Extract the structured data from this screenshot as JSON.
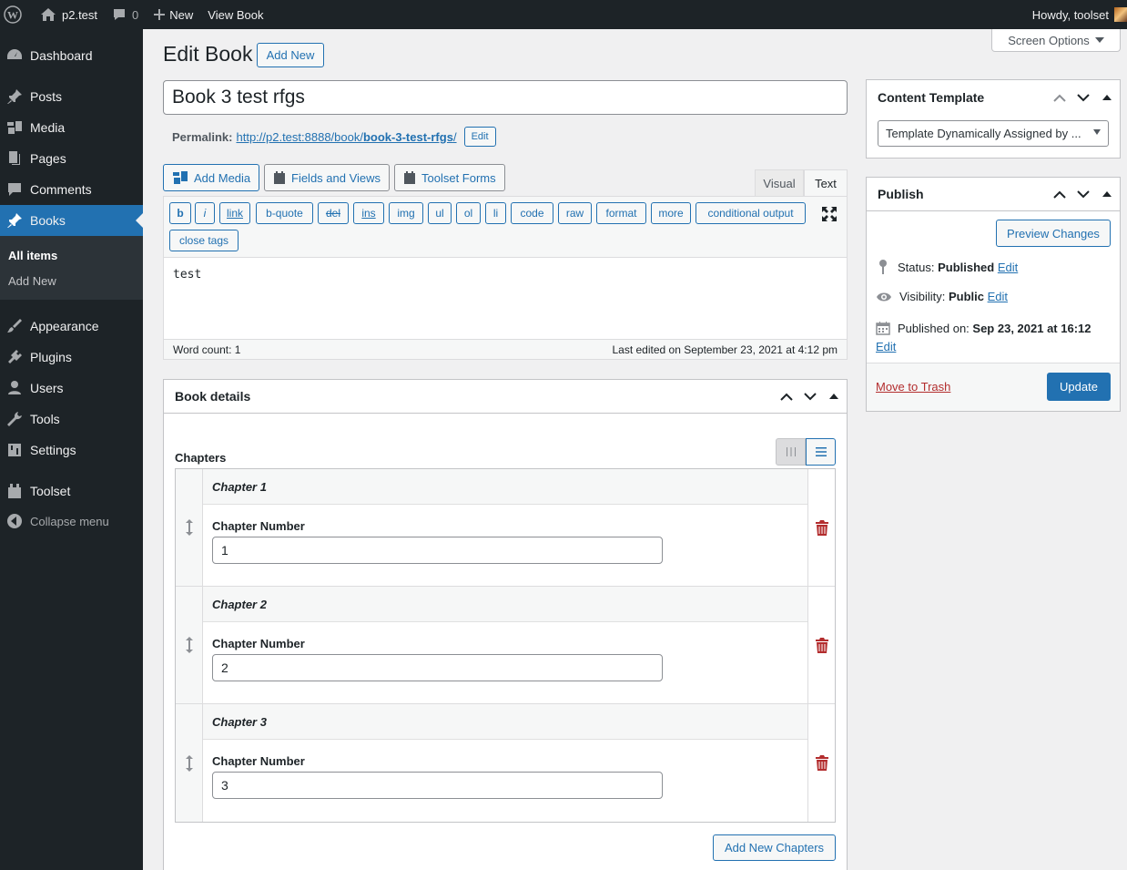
{
  "adminbar": {
    "site_name": "p2.test",
    "comments_count": "0",
    "new_label": "New",
    "view_label": "View Book",
    "howdy": "Howdy, toolset"
  },
  "sidebar": {
    "items": [
      {
        "label": "Dashboard",
        "icon": "dashboard-icon"
      },
      {
        "label": "Posts",
        "icon": "pin-icon"
      },
      {
        "label": "Media",
        "icon": "media-icon"
      },
      {
        "label": "Pages",
        "icon": "pages-icon"
      },
      {
        "label": "Comments",
        "icon": "comments-icon"
      },
      {
        "label": "Books",
        "icon": "pin-icon"
      },
      {
        "label": "Appearance",
        "icon": "brush-icon"
      },
      {
        "label": "Plugins",
        "icon": "plug-icon"
      },
      {
        "label": "Users",
        "icon": "users-icon"
      },
      {
        "label": "Tools",
        "icon": "wrench-icon"
      },
      {
        "label": "Settings",
        "icon": "settings-icon"
      },
      {
        "label": "Toolset",
        "icon": "toolset-icon"
      },
      {
        "label": "Collapse menu",
        "icon": "collapse-icon"
      }
    ],
    "submenu": {
      "all_items": "All items",
      "add_new": "Add New"
    }
  },
  "main": {
    "page_title": "Edit Book",
    "add_new": "Add New",
    "screen_options": "Screen Options",
    "post_title": "Book 3 test rfgs",
    "permalink_label": "Permalink:",
    "permalink_base": "http://p2.test:8888/book/",
    "permalink_slug": "book-3-test-rfgs",
    "permalink_end": "/",
    "permalink_edit": "Edit",
    "add_media": "Add Media",
    "fields_views": "Fields and Views",
    "toolset_forms": "Toolset Forms",
    "tab_visual": "Visual",
    "tab_text": "Text",
    "quicktags": [
      "b",
      "i",
      "link",
      "b-quote",
      "del",
      "ins",
      "img",
      "ul",
      "ol",
      "li",
      "code",
      "raw",
      "format",
      "more",
      "conditional output",
      "close tags"
    ],
    "content": "test",
    "word_count": "Word count: 1",
    "last_edited": "Last edited on September 23, 2021 at 4:12 pm"
  },
  "book_details": {
    "title": "Book details",
    "chapters_label": "Chapters",
    "chapters": [
      {
        "title": "Chapter 1",
        "field_label": "Chapter Number",
        "value": "1"
      },
      {
        "title": "Chapter 2",
        "field_label": "Chapter Number",
        "value": "2"
      },
      {
        "title": "Chapter 3",
        "field_label": "Chapter Number",
        "value": "3"
      }
    ],
    "add_new_chapters": "Add New Chapters"
  },
  "content_template": {
    "title": "Content Template",
    "selected": "Template Dynamically Assigned by ..."
  },
  "publish": {
    "title": "Publish",
    "preview": "Preview Changes",
    "status_label": "Status:",
    "status_value": "Published",
    "visibility_label": "Visibility:",
    "visibility_value": "Public",
    "published_label": "Published on:",
    "published_value": "Sep 23, 2021 at 16:12",
    "edit": "Edit",
    "trash": "Move to Trash",
    "update": "Update"
  },
  "colors": {
    "accent": "#2271b1",
    "sidebar": "#1d2327",
    "danger": "#b32d2e"
  }
}
